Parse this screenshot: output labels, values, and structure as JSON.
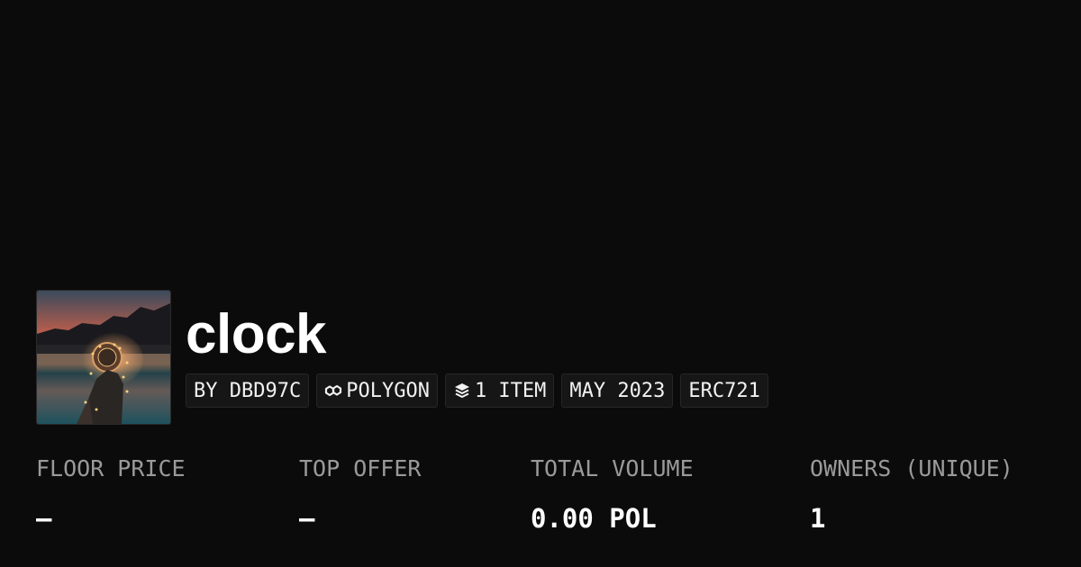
{
  "collection": {
    "name": "clock",
    "avatar_icon": "collection-avatar-image"
  },
  "tags": {
    "creator": "BY DBD97C",
    "chain": "POLYGON",
    "chain_icon": "chain-link-icon",
    "items": "1 ITEM",
    "items_icon": "layers-icon",
    "date": "MAY 2023",
    "standard": "ERC721"
  },
  "stats": {
    "floor_price": {
      "label": "FLOOR PRICE",
      "value": "–"
    },
    "top_offer": {
      "label": "TOP OFFER",
      "value": "–"
    },
    "total_volume": {
      "label": "TOTAL VOLUME",
      "value": "0.00 POL"
    },
    "owners": {
      "label": "OWNERS (UNIQUE)",
      "value": "1"
    }
  },
  "colors": {
    "background": "#0b0b0b",
    "text": "#ffffff",
    "muted": "#9a9a9a",
    "tag_background": "#161616"
  }
}
